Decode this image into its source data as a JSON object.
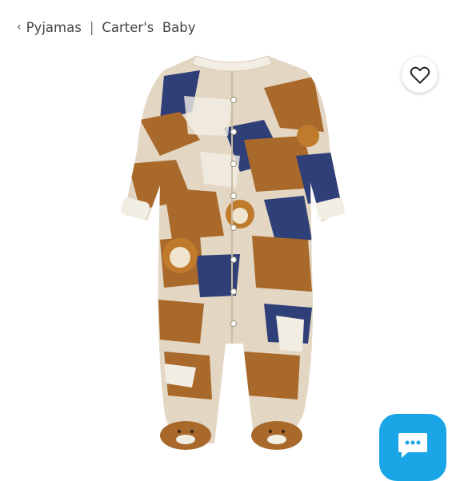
{
  "breadcrumb": {
    "back_icon": "chevron-left-icon",
    "items": [
      "Pyjamas",
      "Carter's  Baby"
    ],
    "separator": "|"
  },
  "favorite": {
    "icon": "heart-outline-icon"
  },
  "chat": {
    "icon": "chat-bubble-icon",
    "color": "#1aa6e6"
  },
  "colors": {
    "tan": "#e3d6c3",
    "brown": "#a8692b",
    "navy": "#2f3f77",
    "cream": "#f3eee4"
  }
}
